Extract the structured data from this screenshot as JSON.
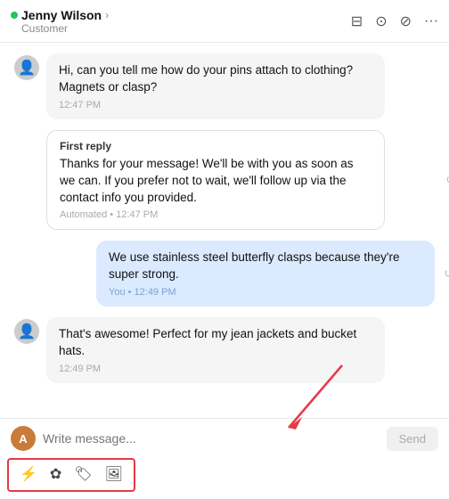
{
  "header": {
    "name": "Jenny Wilson",
    "subtitle": "Customer",
    "online": true
  },
  "messages": [
    {
      "type": "customer",
      "text": "Hi, can you tell me how do your pins attach to clothing? Magnets or clasp?",
      "time": "12:47 PM"
    },
    {
      "type": "auto-reply",
      "title": "First reply",
      "text": "Thanks for your message! We'll be with you as soon as we can. If you prefer not to wait, we'll follow up via the contact info you provided.",
      "time": "Automated • 12:47 PM"
    },
    {
      "type": "own",
      "text": "We use stainless steel butterfly clasps because they're super strong.",
      "time": "You • 12:49 PM"
    },
    {
      "type": "customer",
      "text": "That's awesome! Perfect for my jean jackets and bucket hats.",
      "time": "12:49 PM"
    }
  ],
  "compose": {
    "placeholder": "Write message...",
    "send_label": "Send"
  },
  "toolbar": {
    "icons": [
      "⚡",
      "✿",
      "🏷",
      "🖼"
    ]
  }
}
